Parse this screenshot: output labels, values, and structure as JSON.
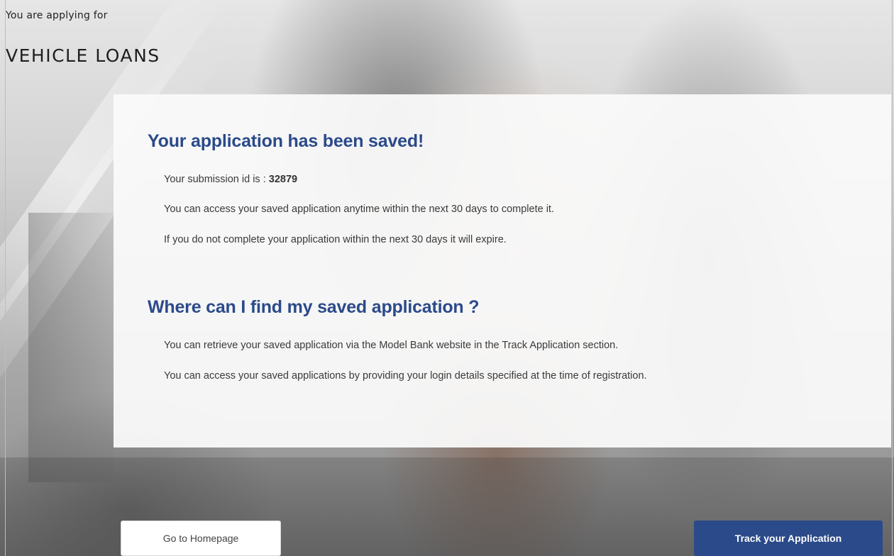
{
  "header": {
    "applying_label": "You are applying for",
    "product_title": "VEHICLE LOANS"
  },
  "confirmation": {
    "heading": "Your application has been saved!",
    "submission_prefix": "Your submission id is : ",
    "submission_id": "32879",
    "access_note": "You can access your saved application anytime within the next 30 days to complete it.",
    "expire_note": "If you do not complete your application within the next 30 days it will expire."
  },
  "find": {
    "heading": "Where can I find my saved application ?",
    "retrieve_note": "You can retrieve your saved application via the Model Bank website in the Track Application section.",
    "login_note": "You can access your saved applications by providing your login details specified at the time of registration."
  },
  "actions": {
    "home_label": "Go to Homepage",
    "track_label": "Track your Application"
  },
  "colors": {
    "accent": "#2b4a8a",
    "card_background": "#fafafa"
  }
}
